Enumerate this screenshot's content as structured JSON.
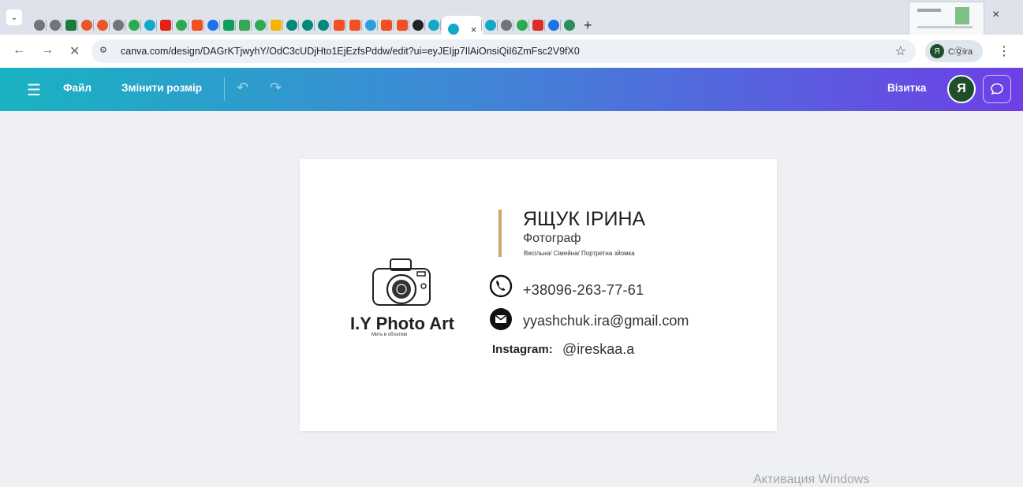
{
  "browser": {
    "tab_dropdown_icon": "chevron-down-icon",
    "favicons": [
      {
        "name": "chrome",
        "color": "#70757a"
      },
      {
        "name": "chrome",
        "color": "#70757a"
      },
      {
        "name": "classroom",
        "color": "#1e7a3a"
      },
      {
        "name": "target",
        "color": "#e8562a"
      },
      {
        "name": "target",
        "color": "#e8562a"
      },
      {
        "name": "chrome",
        "color": "#70757a"
      },
      {
        "name": "drive",
        "color": "#2da94f"
      },
      {
        "name": "canva",
        "color": "#12a8c8"
      },
      {
        "name": "youtube",
        "color": "#e62117"
      },
      {
        "name": "drive",
        "color": "#2da94f"
      },
      {
        "name": "microsoft",
        "color": "#f25022"
      },
      {
        "name": "lens",
        "color": "#1a73e8"
      },
      {
        "name": "sheets",
        "color": "#0f9d58"
      },
      {
        "name": "calendar",
        "color": "#34a853"
      },
      {
        "name": "drive",
        "color": "#2da94f"
      },
      {
        "name": "slides",
        "color": "#f4b400"
      },
      {
        "name": "edu",
        "color": "#00897b"
      },
      {
        "name": "edu",
        "color": "#00897b"
      },
      {
        "name": "edu",
        "color": "#00897b"
      },
      {
        "name": "microsoft",
        "color": "#f25022"
      },
      {
        "name": "microsoft",
        "color": "#f25022"
      },
      {
        "name": "telegram",
        "color": "#2aa1da"
      },
      {
        "name": "microsoft",
        "color": "#f25022"
      },
      {
        "name": "microsoft",
        "color": "#f25022"
      },
      {
        "name": "openai",
        "color": "#222222"
      },
      {
        "name": "canva",
        "color": "#12a8c8"
      }
    ],
    "active_tab_favicon": {
      "name": "canva",
      "color": "#12a8c8"
    },
    "favicons_after": [
      {
        "name": "canva",
        "color": "#12a8c8"
      },
      {
        "name": "chrome",
        "color": "#70757a"
      },
      {
        "name": "drive",
        "color": "#2da94f"
      },
      {
        "name": "maps",
        "color": "#d93025"
      },
      {
        "name": "onenote",
        "color": "#1a73e8"
      },
      {
        "name": "grammarly",
        "color": "#2d8e5a"
      }
    ],
    "new_tab": "+",
    "close_glyph": "×",
    "url": "canva.com/design/DAGrKTjwyhY/OdC3cUDjHto1EjEzfsPddw/edit?ui=eyJEIjp7IlAiOnsiQiI6ZmFsc2V9fX0",
    "profile_initial": "Я",
    "profile_label": "CⓆira"
  },
  "toolbar": {
    "file": "Файл",
    "resize": "Змінити розмір",
    "doc_title": "Візитка",
    "avatar_initial": "Я"
  },
  "card": {
    "brand": "I.Y Photo Art",
    "brand_sub": "Мить в об'єктиві",
    "name": "ЯЩУК ІРИНА",
    "role": "Фотограф",
    "services": "Весільна/ Сімейна/ Портретна зйомка",
    "phone": "+38096-263-77-61",
    "email": "yyashchuk.ira@gmail.com",
    "instagram_label": "Instagram:",
    "instagram": "@ireskaa.a",
    "accent_color": "#c9a96a"
  },
  "os": {
    "watermark": "Активация Windows"
  }
}
